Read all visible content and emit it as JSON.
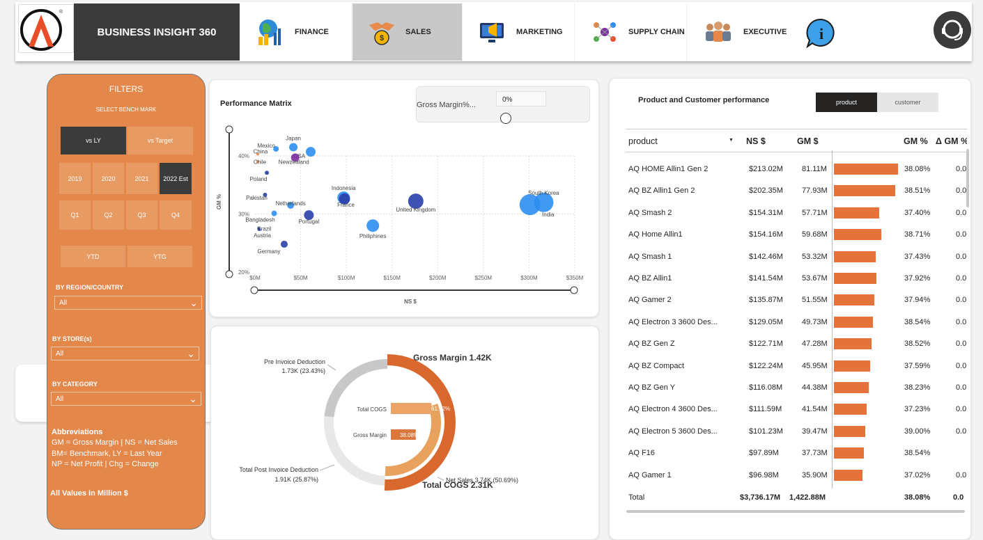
{
  "brand": {
    "title": "BUSINESS INSIGHT 360"
  },
  "nav": [
    {
      "label": "FINANCE",
      "icon": "globe-chart-icon",
      "active": false
    },
    {
      "label": "SALES",
      "icon": "handshake-coin-icon",
      "active": true
    },
    {
      "label": "MARKETING",
      "icon": "megaphone-monitor-icon",
      "active": false
    },
    {
      "label": "SUPPLY CHAIN",
      "icon": "supply-network-icon",
      "active": false
    },
    {
      "label": "EXECUTIVE",
      "icon": "executives-icon",
      "active": false
    }
  ],
  "filters": {
    "title": "FILTERS",
    "benchmark_label": "SELECT BENCH MARK",
    "benchmarks": [
      "vs LY",
      "vs Target"
    ],
    "benchmark_selected": "vs LY",
    "years": [
      "2019",
      "2020",
      "2021",
      "2022 Est"
    ],
    "year_selected": "2022 Est",
    "quarters": [
      "Q1",
      "Q2",
      "Q3",
      "Q4"
    ],
    "periods": [
      "YTD",
      "YTG"
    ],
    "region_label": "BY REGION/COUNTRY",
    "region_value": "All",
    "store_label": "BY STORE(s)",
    "store_value": "All",
    "category_label": "BY CATEGORY",
    "category_value": "All",
    "abbr_title": "Abbreviations",
    "abbr_lines": [
      "GM = Gross Margin | NS = Net  Sales",
      "BM= Benchmark, LY = Last Year",
      "NP = Net Profit | Chg = Change"
    ],
    "footnote": "All Values in Million $"
  },
  "matrix": {
    "title": "Performance Matrix",
    "slicer_label": "Gross Margin%...",
    "slicer_value": "0%",
    "xlabel": "NS $",
    "ylabel": "GM %"
  },
  "chart_data": [
    {
      "type": "scatter",
      "title": "Performance Matrix",
      "xlabel": "NS $",
      "ylabel": "GM %",
      "xlim": [
        0,
        350
      ],
      "ylim": [
        20,
        45
      ],
      "x_ticks": [
        "$0M",
        "$50M",
        "$100M",
        "$150M",
        "$200M",
        "$250M",
        "$300M",
        "$350M"
      ],
      "y_ticks": [
        "40%",
        "30%",
        "20%"
      ],
      "points": [
        {
          "label": "Japan",
          "x": 42,
          "y": 41.5,
          "r": 6,
          "color": "#2d8ef0"
        },
        {
          "label": "Mexico",
          "x": 23,
          "y": 41.2,
          "r": 4,
          "color": "#2d8ef0"
        },
        {
          "label": "USA",
          "x": 61,
          "y": 40.7,
          "r": 7,
          "color": "#2d8ef0"
        },
        {
          "label": "China",
          "x": 3,
          "y": 40.3,
          "r": 2,
          "color": "#e3874b"
        },
        {
          "label": "Newzealand",
          "x": 44,
          "y": 39.7,
          "r": 6,
          "color": "#7b2fa0"
        },
        {
          "label": "Chile",
          "x": 3,
          "y": 39.0,
          "r": 2,
          "color": "#e3874b"
        },
        {
          "label": "Poland",
          "x": 13,
          "y": 37.1,
          "r": 3,
          "color": "#2a3fa8"
        },
        {
          "label": "Indonesia",
          "x": 97,
          "y": 32.8,
          "r": 9,
          "color": "#2d8ef0"
        },
        {
          "label": "Pakistan",
          "x": 11,
          "y": 33.3,
          "r": 3,
          "color": "#2a3fa8"
        },
        {
          "label": "France",
          "x": 98,
          "y": 32.6,
          "r": 8,
          "color": "#2a3fa8"
        },
        {
          "label": "United Kingdom",
          "x": 176,
          "y": 32.2,
          "r": 11,
          "color": "#2a3fa8"
        },
        {
          "label": "South Korea",
          "x": 316,
          "y": 32.0,
          "r": 14,
          "color": "#2d8ef0"
        },
        {
          "label": "India",
          "x": 301,
          "y": 31.6,
          "r": 15,
          "color": "#2d8ef0"
        },
        {
          "label": "Netherlands",
          "x": 39,
          "y": 31.5,
          "r": 5,
          "color": "#2d8ef0"
        },
        {
          "label": "Bangladesh",
          "x": 21,
          "y": 30.1,
          "r": 4,
          "color": "#2d8ef0"
        },
        {
          "label": "Portugal",
          "x": 59,
          "y": 29.8,
          "r": 7,
          "color": "#2a3fa8"
        },
        {
          "label": "Philiphines",
          "x": 129,
          "y": 28.0,
          "r": 9,
          "color": "#2d8ef0"
        },
        {
          "label": "Brazil",
          "x": 4,
          "y": 27.5,
          "r": 2,
          "color": "#2a3fa8"
        },
        {
          "label": "Austria",
          "x": 5,
          "y": 27.3,
          "r": 2,
          "color": "#2a3fa8"
        },
        {
          "label": "Germany",
          "x": 32,
          "y": 24.8,
          "r": 5,
          "color": "#2a3fa8"
        }
      ]
    },
    {
      "type": "pie",
      "title": "",
      "segments": [
        {
          "label": "Gross Margin 1.42K",
          "value": 1420,
          "color": "#d9682f"
        },
        {
          "label": "Total COGS 2.31K",
          "value": 2310,
          "color": "#e9a25e"
        },
        {
          "label": "Pre Invoice Deduction",
          "detail": "1.73K (23.43%)",
          "value": 1730,
          "color": "#c8c8c8"
        },
        {
          "label": "Total Post Invoice Deduction",
          "detail": "1.91K (25.87%)",
          "value": 1910,
          "color": "#e8e8e8"
        },
        {
          "label": "Net Sales 3.74K (50.69%)",
          "value": 3740,
          "color": "#d9682f"
        }
      ],
      "inner_bars": [
        {
          "label": "Total COGS",
          "value": 61.92,
          "text": "61.92%"
        },
        {
          "label": "Gross Margin",
          "value": 38.08,
          "text": "38.08%"
        }
      ]
    }
  ],
  "waterfall": {
    "pre_invoice": "Pre Invoice Deduction",
    "pre_invoice_val": "1.73K (23.43%)",
    "post_invoice": "Total Post Invoice Deduction",
    "post_invoice_val": "1.91K (25.87%)",
    "gross_margin": "Gross Margin 1.42K",
    "total_cogs": "Total COGS 2.31K",
    "net_sales": "Net Sales 3.74K (50.69%)",
    "bar1_label": "Total COGS",
    "bar1_value": "61.92%",
    "bar2_label": "Gross Margin",
    "bar2_value": "38.08%"
  },
  "table": {
    "title": "Product and Customer performance",
    "toggle": [
      "product",
      "customer"
    ],
    "toggle_selected": "product",
    "columns": [
      "product",
      "NS $",
      "GM $",
      "GM %",
      "Δ GM %"
    ],
    "rows": [
      {
        "product": "AQ HOME Allin1 Gen 2",
        "ns": "$213.02M",
        "gm": "81.11M",
        "gm_val": 81.11,
        "gmp": "38.08%",
        "dgm": "0.0"
      },
      {
        "product": "AQ BZ Allin1 Gen 2",
        "ns": "$202.35M",
        "gm": "77.93M",
        "gm_val": 77.93,
        "gmp": "38.51%",
        "dgm": "0.0"
      },
      {
        "product": "AQ Smash 2",
        "ns": "$154.31M",
        "gm": "57.71M",
        "gm_val": 57.71,
        "gmp": "37.40%",
        "dgm": "0.0"
      },
      {
        "product": "AQ Home Allin1",
        "ns": "$154.16M",
        "gm": "59.68M",
        "gm_val": 59.68,
        "gmp": "38.71%",
        "dgm": "0.0"
      },
      {
        "product": "AQ Smash 1",
        "ns": "$142.46M",
        "gm": "53.32M",
        "gm_val": 53.32,
        "gmp": "37.43%",
        "dgm": "0.0"
      },
      {
        "product": "AQ BZ Allin1",
        "ns": "$141.54M",
        "gm": "53.67M",
        "gm_val": 53.67,
        "gmp": "37.92%",
        "dgm": "0.0"
      },
      {
        "product": "AQ Gamer 2",
        "ns": "$135.87M",
        "gm": "51.55M",
        "gm_val": 51.55,
        "gmp": "37.94%",
        "dgm": "0.0"
      },
      {
        "product": "AQ Electron 3 3600 Des...",
        "ns": "$129.05M",
        "gm": "49.73M",
        "gm_val": 49.73,
        "gmp": "38.54%",
        "dgm": "0.0"
      },
      {
        "product": "AQ BZ Gen Z",
        "ns": "$122.71M",
        "gm": "47.28M",
        "gm_val": 47.28,
        "gmp": "38.52%",
        "dgm": "0.0"
      },
      {
        "product": "AQ BZ Compact",
        "ns": "$122.24M",
        "gm": "45.95M",
        "gm_val": 45.95,
        "gmp": "37.59%",
        "dgm": "0.0"
      },
      {
        "product": "AQ BZ Gen Y",
        "ns": "$116.08M",
        "gm": "44.38M",
        "gm_val": 44.38,
        "gmp": "38.23%",
        "dgm": "0.0"
      },
      {
        "product": "AQ Electron 4 3600 Des...",
        "ns": "$111.59M",
        "gm": "41.54M",
        "gm_val": 41.54,
        "gmp": "37.23%",
        "dgm": "0.0"
      },
      {
        "product": "AQ Electron 5 3600 Des...",
        "ns": "$101.23M",
        "gm": "39.47M",
        "gm_val": 39.47,
        "gmp": "39.00%",
        "dgm": "0.0"
      },
      {
        "product": "AQ F16",
        "ns": "$97.89M",
        "gm": "37.73M",
        "gm_val": 37.73,
        "gmp": "38.54%",
        "dgm": ""
      },
      {
        "product": "AQ Gamer 1",
        "ns": "$96.98M",
        "gm": "35.90M",
        "gm_val": 35.9,
        "gmp": "37.02%",
        "dgm": "0.0"
      }
    ],
    "total": {
      "label": "Total",
      "ns": "$3,736.17M",
      "gm": "1,422.88M",
      "gmp": "38.08%",
      "dgm": "0.0"
    }
  }
}
